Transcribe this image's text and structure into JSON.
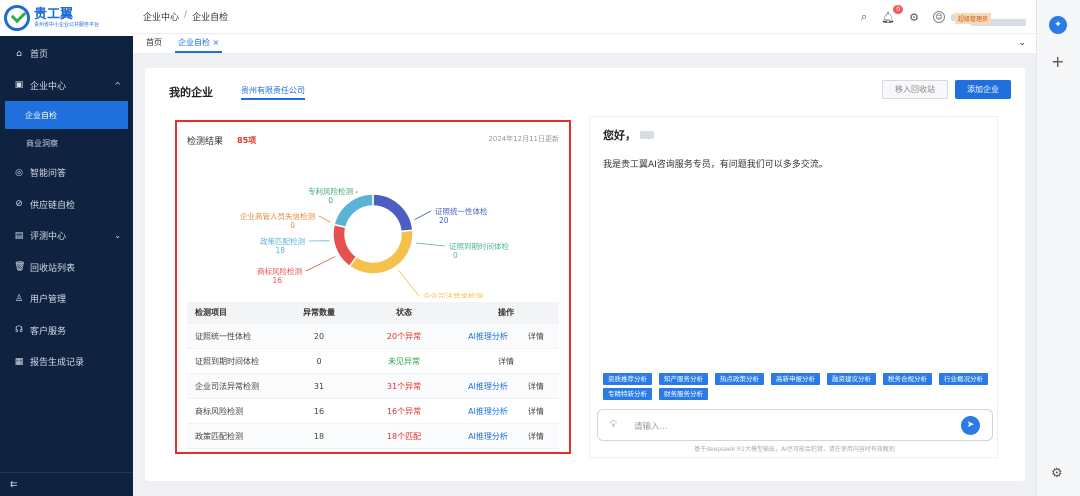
{
  "logo": {
    "title": "贵工翼",
    "subtitle": "贵州省中小企业公共服务平台"
  },
  "sidebar": {
    "items": [
      {
        "label": "首页",
        "icon": "home-icon",
        "glyph": "⌂"
      },
      {
        "label": "企业中心",
        "icon": "briefcase-icon",
        "glyph": "▣",
        "chevron": "^"
      },
      {
        "label": "企业自检",
        "sub": true,
        "active": true
      },
      {
        "label": "商业洞察",
        "sub": true
      },
      {
        "label": "智能问答",
        "icon": "chat-icon",
        "glyph": "◎"
      },
      {
        "label": "供应链自检",
        "icon": "link-icon",
        "glyph": "⊘"
      },
      {
        "label": "评测中心",
        "icon": "doc-icon",
        "glyph": "▤",
        "chevron": "⌄"
      },
      {
        "label": "回收站列表",
        "icon": "trash-icon",
        "glyph": "🗑"
      },
      {
        "label": "用户管理",
        "icon": "user-icon",
        "glyph": "♙"
      },
      {
        "label": "客户服务",
        "icon": "headset-icon",
        "glyph": "☊"
      },
      {
        "label": "报告生成记录",
        "icon": "report-icon",
        "glyph": "▦"
      }
    ],
    "collapse_glyph": "⇇"
  },
  "topbar": {
    "breadcrumb": [
      "企业中心",
      "企业自检"
    ],
    "sep": "/",
    "notif_count": "0",
    "role": "超级管理员"
  },
  "tabs": [
    {
      "label": "首页"
    },
    {
      "label": "企业自检 ×",
      "active": true
    }
  ],
  "main": {
    "heading": "我的企业",
    "company_tab": "贵州有限责任公司",
    "recycle_button": "移入回收站",
    "add_button": "添加企业"
  },
  "results": {
    "title": "检测结果",
    "count": "85项",
    "date": "2024年12月11日更新",
    "columns": [
      "检测项目",
      "异常数量",
      "状态",
      "操作"
    ],
    "rows": [
      {
        "item": "证照统一性体检",
        "count": "20",
        "status": "20个异常",
        "status_color": "red",
        "ai": "AI推理分析",
        "detail": "详情"
      },
      {
        "item": "证照到期时间体检",
        "count": "0",
        "status": "未见异常",
        "status_color": "green",
        "ai": "",
        "detail": "详情"
      },
      {
        "item": "企业司法异常检测",
        "count": "31",
        "status": "31个异常",
        "status_color": "red",
        "ai": "AI推理分析",
        "detail": "详情"
      },
      {
        "item": "商标风险检测",
        "count": "16",
        "status": "16个异常",
        "status_color": "red",
        "ai": "AI推理分析",
        "detail": "详情"
      },
      {
        "item": "政策匹配检测",
        "count": "18",
        "status": "18个匹配",
        "status_color": "red",
        "ai": "AI推理分析",
        "detail": "详情"
      }
    ]
  },
  "chart_data": {
    "type": "pie",
    "title": "",
    "slices": [
      {
        "name": "证照统一性体检",
        "value": 20,
        "color": "#4a5fc1"
      },
      {
        "name": "证照到期时间体检",
        "value": 0,
        "color": "#4cb88a"
      },
      {
        "name": "企业司法异常检测",
        "value": 31,
        "color": "#f5c14b"
      },
      {
        "name": "商标风险检测",
        "value": 16,
        "color": "#e6514f"
      },
      {
        "name": "政策匹配检测",
        "value": 18,
        "color": "#5ab4d6"
      },
      {
        "name": "企业高管人员失信检测",
        "value": 0,
        "color": "#e98a3e"
      },
      {
        "name": "专利风险检测",
        "value": 0,
        "color": "#3da86f"
      }
    ]
  },
  "assistant": {
    "greeting": "您好，",
    "intro": "我是贵工翼AI咨询服务专员，有问题我们可以多多交流。",
    "chips": [
      "资质推荐分析",
      "知产服务分析",
      "热点政策分析",
      "高新申报分析",
      "融资建议分析",
      "税务合规分析",
      "行业概况分析",
      "专精特新分析",
      "财务服务分析"
    ],
    "placeholder": "请输入...",
    "disclaimer": "基于deepseek R1大模型输出，AI也可能会犯错，请在使用内容时有效甄别"
  }
}
